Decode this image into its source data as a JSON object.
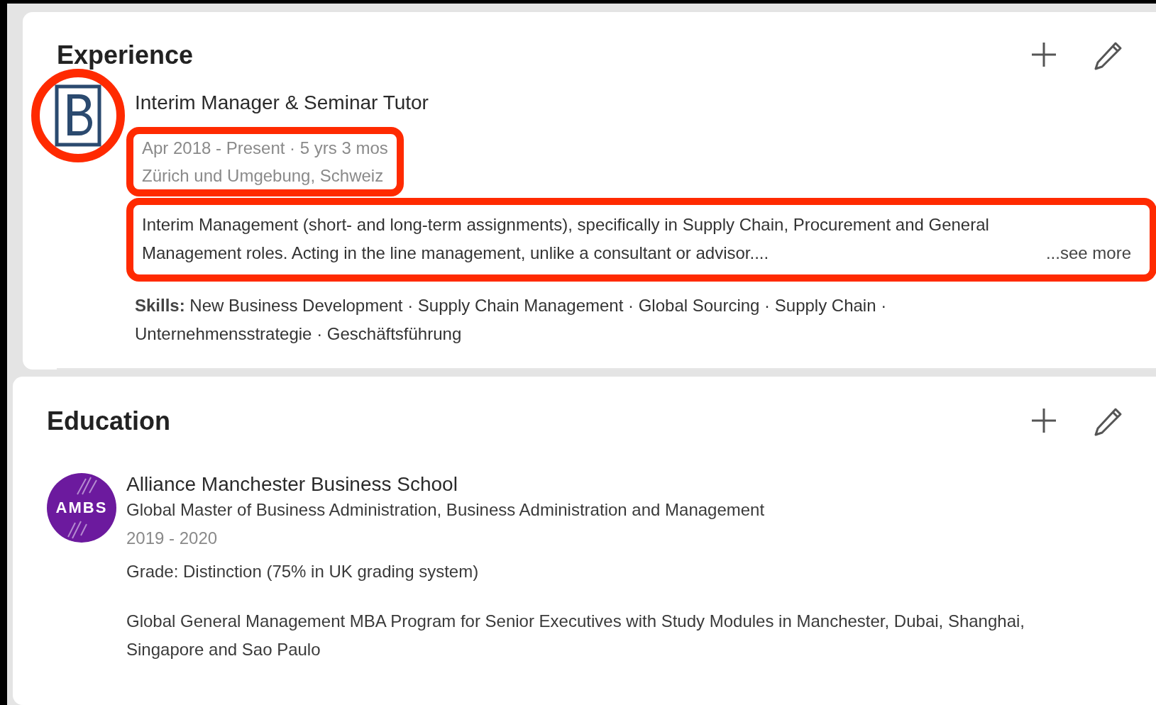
{
  "experience": {
    "title": "Experience",
    "items": [
      {
        "logo_highlighted": true,
        "title": "Interim Manager & Seminar Tutor",
        "dates": "Apr 2018 - Present · 5 yrs 3 mos",
        "location": "Zürich und Umgebung, Schweiz",
        "meta_highlighted": true,
        "description": "Interim Management (short- and long-term assignments), specifically in Supply Chain, Procurement and General Management roles. Acting in the line management, unlike a consultant or advisor....",
        "description_highlighted": true,
        "see_more": "...see more",
        "skills": "**Skills:** New Business Development · Supply Chain Management · Global Sourcing · Supply Chain · Unternehmensstrategie · Geschäftsführung"
      }
    ]
  },
  "education": {
    "title": "Education",
    "items": [
      {
        "logo": "AMBS",
        "school": "Alliance Manchester Business School",
        "degree": "Global Master of Business Administration, Business Administration and Management",
        "years": "2019 - 2020",
        "grade": "Grade: Distinction (75% in UK grading system)",
        "description": "Global General Management MBA Program for Senior Executives with Study Modules in Manchester, Dubai, Shanghai, Singapore and Sao Paulo"
      }
    ]
  }
}
